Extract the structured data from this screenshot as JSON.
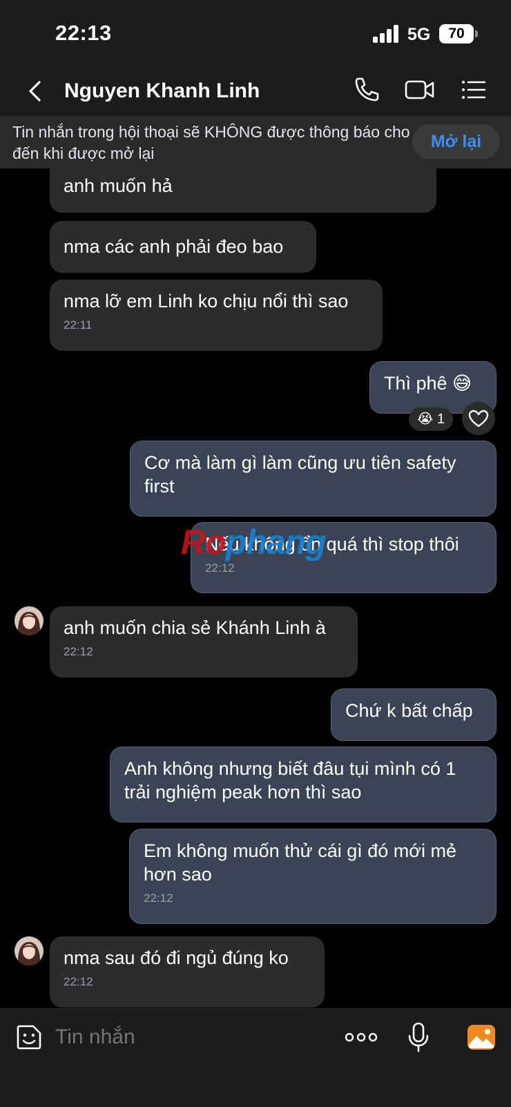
{
  "status": {
    "time": "22:13",
    "network": "5G",
    "battery": "70"
  },
  "header": {
    "contact_name": "Nguyen Khanh Linh"
  },
  "banner": {
    "text": "Tin nhắn trong hội thoại sẽ KHÔNG được thông báo cho đến khi được mở lại",
    "button_label": "Mở lại"
  },
  "messages": [
    {
      "text": "anh muốn hả"
    },
    {
      "text": "nma các anh phải đeo bao"
    },
    {
      "text": "nma lỡ em Linh ko chịu nổi thì sao",
      "time": "22:11"
    },
    {
      "text": "Thì phê 😅"
    },
    {
      "text": "Cơ mà làm gì làm cũng ưu tiên safety first"
    },
    {
      "text": "Nếu không ổn quá thì stop thôi",
      "time": "22:12"
    },
    {
      "text": "anh muốn chia sẻ Khánh Linh à",
      "time": "22:12"
    },
    {
      "text": "Chứ k bất chấp"
    },
    {
      "text": "Anh không nhưng biết đâu tụi mình có 1 trải nghiệm peak hơn thì sao"
    },
    {
      "text": "Em không muốn thử cái gì đó mới mẻ hơn sao",
      "time": "22:12"
    },
    {
      "text": "nma sau đó đi ngủ đúng ko",
      "time": "22:12"
    }
  ],
  "reaction": {
    "emoji": "😭",
    "count": "1"
  },
  "watermark": {
    "part1": "Ro",
    "part2": "phang"
  },
  "input": {
    "placeholder": "Tin nhắn"
  },
  "colors": {
    "accent": "#3d8ff0",
    "outgoing_bubble": "#3a4454",
    "incoming_bubble": "#2c2c2e",
    "image_button": "#f08a1c"
  },
  "icons": [
    "back-chevron-icon",
    "phone-icon",
    "video-camera-icon",
    "list-menu-icon",
    "sticker-icon",
    "more-dots-icon",
    "microphone-icon",
    "image-icon",
    "heart-icon"
  ]
}
